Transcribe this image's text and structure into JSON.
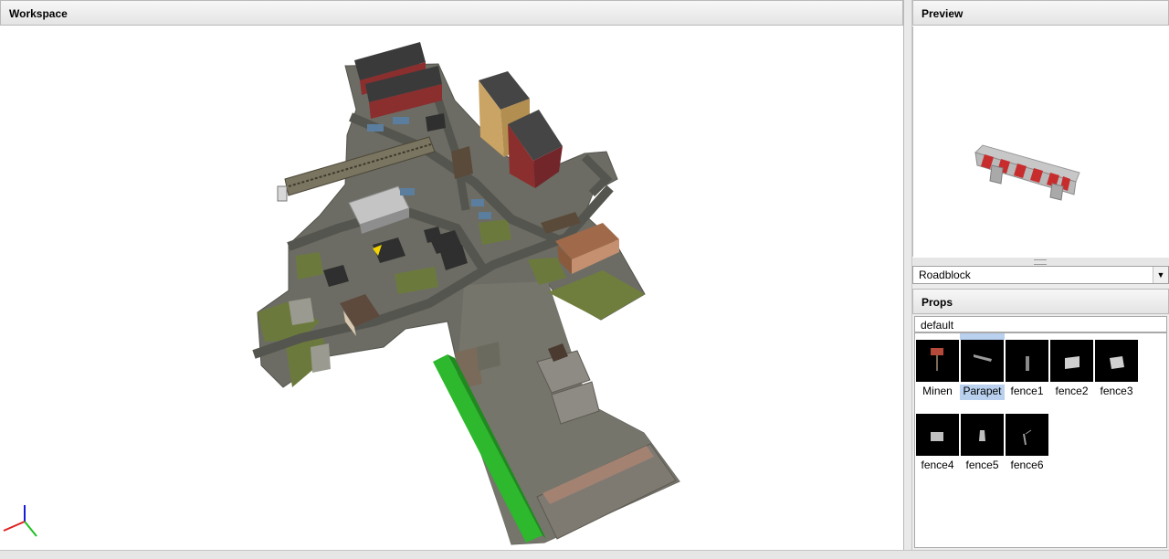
{
  "workspace": {
    "title": "Workspace"
  },
  "preview": {
    "title": "Preview",
    "model": "Parapet"
  },
  "category": {
    "selected": "Roadblock"
  },
  "props": {
    "title": "Props",
    "tab": "default",
    "items": [
      {
        "label": "Minen",
        "icon": "sign-icon"
      },
      {
        "label": "Parapet",
        "icon": "barrier-icon",
        "selected": true
      },
      {
        "label": "fence1",
        "icon": "post-icon"
      },
      {
        "label": "fence2",
        "icon": "block-icon"
      },
      {
        "label": "fence3",
        "icon": "block-icon"
      },
      {
        "label": "fence4",
        "icon": "block-icon"
      },
      {
        "label": "fence5",
        "icon": "post-icon"
      },
      {
        "label": "fence6",
        "icon": "post-icon"
      }
    ]
  },
  "colors": {
    "ground": "#6b6b62",
    "road": "#5d5d57",
    "grass": "#6a7a3a",
    "brick": "#8a2d2d",
    "tower": "#c9a464",
    "roof": "#3b3b3b",
    "selection_green": "#2db82d",
    "accent": "#b9d1ee"
  }
}
